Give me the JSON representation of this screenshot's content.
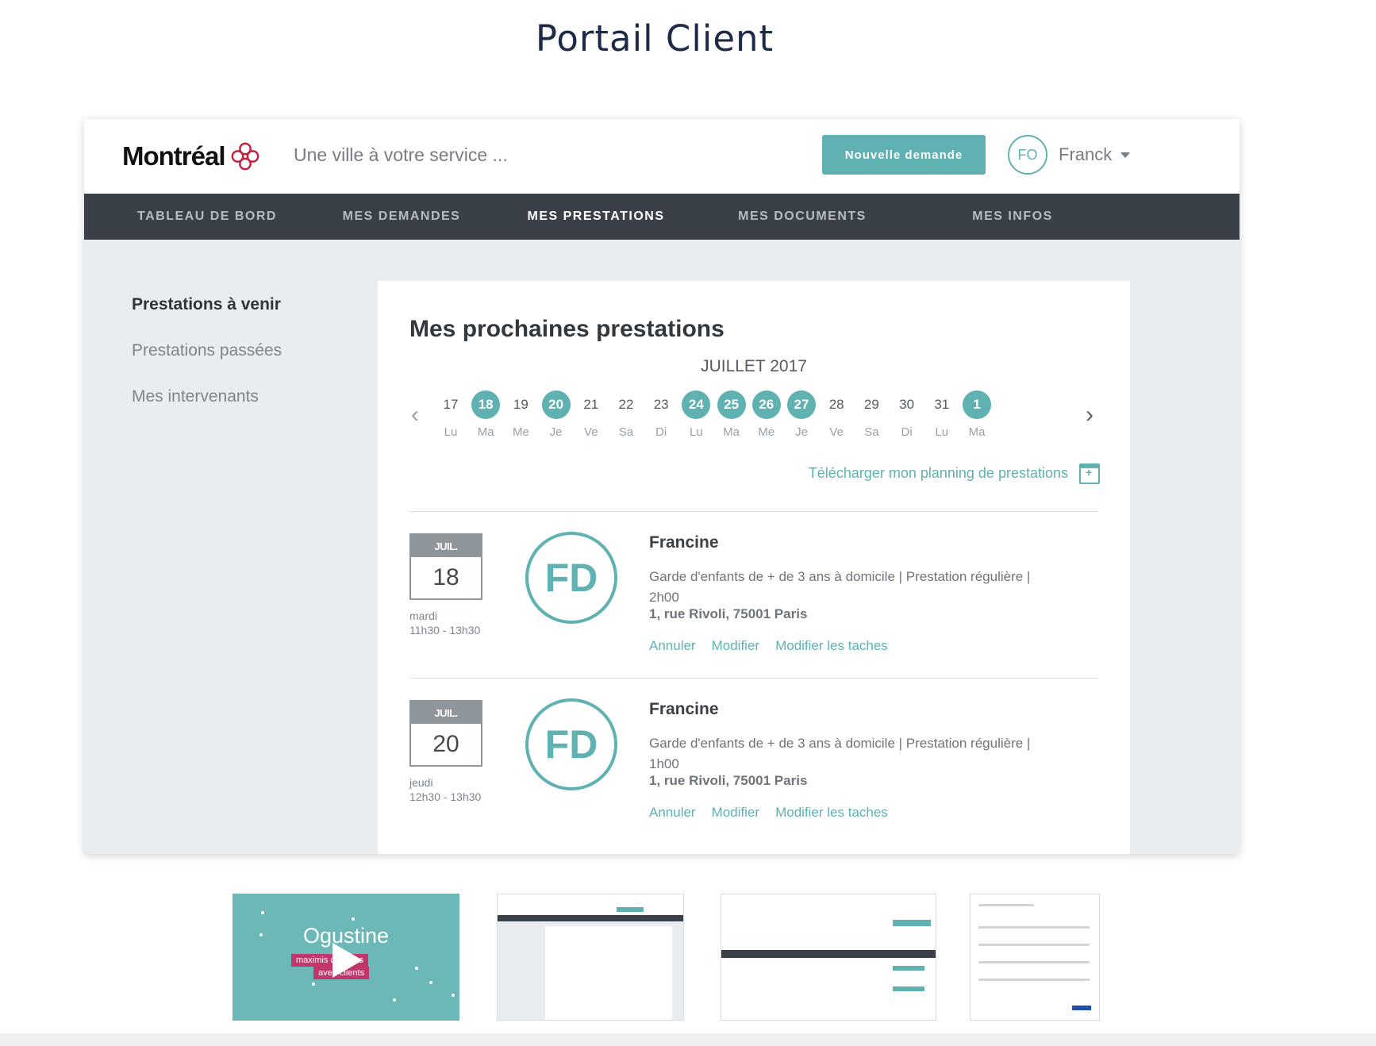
{
  "page": {
    "title": "Portail Client"
  },
  "header": {
    "logo_text": "Montréal",
    "tagline": "Une ville à votre service ...",
    "new_request_label": "Nouvelle demande",
    "user_initials": "FO",
    "user_name": "Franck"
  },
  "nav": {
    "items": [
      {
        "label": "TABLEAU DE BORD"
      },
      {
        "label": "MES DEMANDES"
      },
      {
        "label": "MES PRESTATIONS"
      },
      {
        "label": "MES DOCUMENTS"
      },
      {
        "label": "MES INFOS"
      }
    ],
    "active_label": "MES PRESTATIONS"
  },
  "sidebar": {
    "items": [
      {
        "label": "Prestations à venir"
      },
      {
        "label": "Prestations passées"
      },
      {
        "label": "Mes intervenants"
      }
    ]
  },
  "main": {
    "title": "Mes prochaines prestations",
    "month": "JUILLET 2017",
    "days": [
      {
        "num": "17",
        "wd": "Lu",
        "sel": false
      },
      {
        "num": "18",
        "wd": "Ma",
        "sel": true
      },
      {
        "num": "19",
        "wd": "Me",
        "sel": false
      },
      {
        "num": "20",
        "wd": "Je",
        "sel": true
      },
      {
        "num": "21",
        "wd": "Ve",
        "sel": false
      },
      {
        "num": "22",
        "wd": "Sa",
        "sel": false
      },
      {
        "num": "23",
        "wd": "Di",
        "sel": false
      },
      {
        "num": "24",
        "wd": "Lu",
        "sel": true
      },
      {
        "num": "25",
        "wd": "Ma",
        "sel": true
      },
      {
        "num": "26",
        "wd": "Me",
        "sel": true
      },
      {
        "num": "27",
        "wd": "Je",
        "sel": true
      },
      {
        "num": "28",
        "wd": "Ve",
        "sel": false
      },
      {
        "num": "29",
        "wd": "Sa",
        "sel": false
      },
      {
        "num": "30",
        "wd": "Di",
        "sel": false
      },
      {
        "num": "31",
        "wd": "Lu",
        "sel": false
      },
      {
        "num": "1",
        "wd": "Ma",
        "sel": true
      }
    ],
    "download_label": "Télécharger mon planning de prestations",
    "appointments": [
      {
        "month": "JUIL.",
        "day": "18",
        "weekday": "mardi",
        "hours": "11h30 - 13h30",
        "initials": "FD",
        "name": "Francine",
        "desc_line1": "Garde d'enfants de + de 3 ans à domicile  |   Prestation régulière  |",
        "desc_line2": "2h00",
        "address": "1, rue Rivoli, 75001 Paris",
        "action_cancel": "Annuler",
        "action_edit": "Modifier",
        "action_tasks": "Modifier les taches"
      },
      {
        "month": "JUIL.",
        "day": "20",
        "weekday": "jeudi",
        "hours": "12h30 - 13h30",
        "initials": "FD",
        "name": "Francine",
        "desc_line1": "Garde d'enfants de + de 3 ans à domicile  |   Prestation régulière  |",
        "desc_line2": "1h00",
        "address": "1, rue Rivoli, 75001 Paris",
        "action_cancel": "Annuler",
        "action_edit": "Modifier",
        "action_tasks": "Modifier les taches"
      }
    ]
  },
  "thumbnails": {
    "video_title": "Ogustine",
    "video_sub1": "maximis    changes",
    "video_sub2": "aved    clients"
  }
}
